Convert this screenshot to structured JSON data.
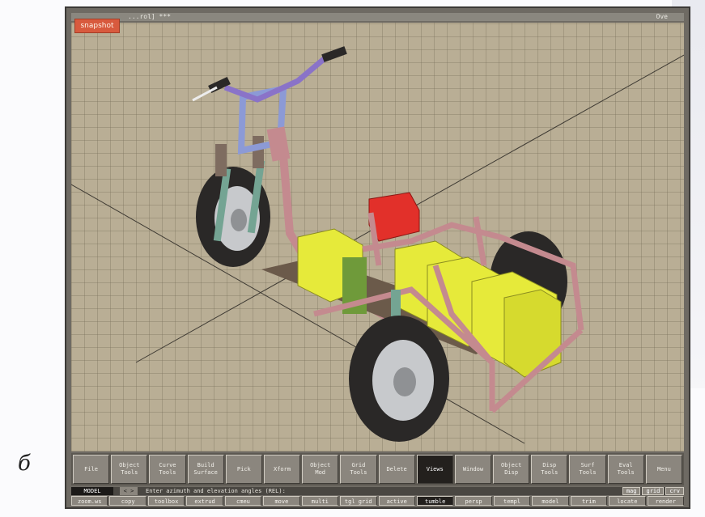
{
  "figure_label": "б",
  "titlebar": {
    "left": "",
    "middle": "...rol] ***",
    "right": "Ove"
  },
  "snapshot_label": "snapshot",
  "toolbar": [
    {
      "label": "File"
    },
    {
      "label": "Object\nTools"
    },
    {
      "label": "Curve\nTools"
    },
    {
      "label": "Build\nSurface"
    },
    {
      "label": "Pick"
    },
    {
      "label": "Xform"
    },
    {
      "label": "Object\nMod"
    },
    {
      "label": "Grid\nTools"
    },
    {
      "label": "Delete"
    },
    {
      "label": "Views",
      "active": true
    },
    {
      "label": "Window"
    },
    {
      "label": "Object\nDisp"
    },
    {
      "label": "Disp\nTools"
    },
    {
      "label": "Surf\nTools"
    },
    {
      "label": "Eval\nTools"
    },
    {
      "label": "Menu"
    }
  ],
  "cmdline": {
    "mode": "MODEL",
    "arrows": "< >",
    "prompt": "Enter azimuth and elevation angles (REL):",
    "right_buttons": [
      "mag",
      "grid",
      "crv"
    ]
  },
  "hotkeys": [
    {
      "label": "zoom.ws"
    },
    {
      "label": "copy"
    },
    {
      "label": "toolbox"
    },
    {
      "label": "extrud"
    },
    {
      "label": "cmeu"
    },
    {
      "label": "move"
    },
    {
      "label": "multi"
    },
    {
      "label": "tgl grid"
    },
    {
      "label": "active"
    },
    {
      "label": "tumble",
      "active": true
    },
    {
      "label": "persp"
    },
    {
      "label": "templ"
    },
    {
      "label": "model"
    },
    {
      "label": "trim"
    },
    {
      "label": "locate"
    },
    {
      "label": "render"
    }
  ],
  "colors": {
    "frame": "#c48a8f",
    "battery": "#e6ea3a",
    "handlebar": "#8a73c8",
    "fork": "#8c9ad6",
    "seat": "#e2302a",
    "tire": "#2a2827",
    "rim": "#c7c9cc",
    "viewport_bg": "#b9ae95"
  }
}
